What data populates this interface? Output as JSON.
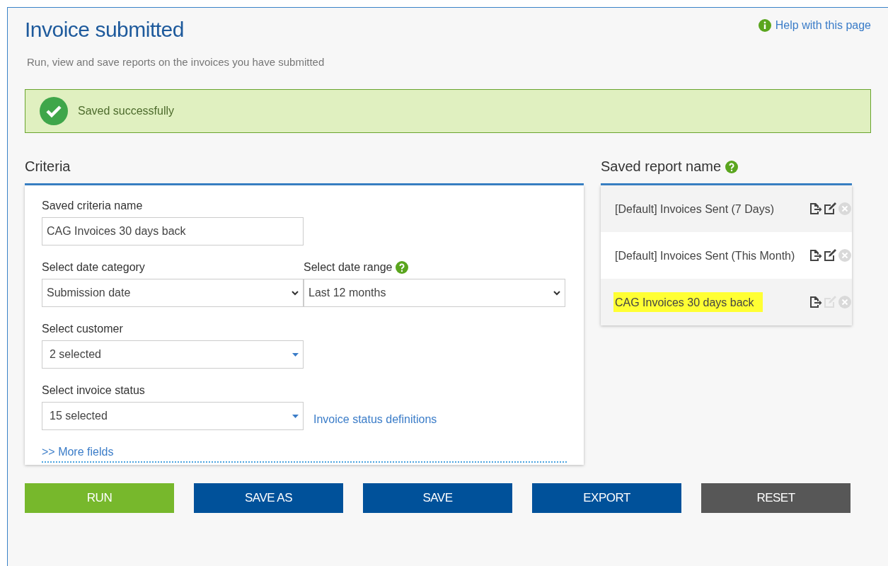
{
  "page": {
    "title": "Invoice submitted",
    "subtitle": "Run, view and save reports on the invoices you have submitted",
    "help_link": "Help with this page"
  },
  "alert": {
    "kind": "success",
    "message": "Saved successfully"
  },
  "criteria": {
    "heading": "Criteria",
    "name_field": {
      "label": "Saved criteria name",
      "value": "CAG Invoices 30 days back"
    },
    "date_category": {
      "label": "Select date category",
      "value": "Submission date"
    },
    "date_range": {
      "label": "Select date range",
      "value": "Last 12 months"
    },
    "customer": {
      "label": "Select customer",
      "value": "2 selected"
    },
    "invoice_status": {
      "label": "Select invoice status",
      "value": "15 selected",
      "link": "Invoice status definitions"
    },
    "more_fields": ">> More fields"
  },
  "saved_reports": {
    "heading": "Saved report name",
    "items": [
      {
        "name": "[Default] Invoices Sent (7 Days)",
        "highlighted": false,
        "edit_disabled": false
      },
      {
        "name": "[Default] Invoices Sent (This Month)",
        "highlighted": false,
        "edit_disabled": false
      },
      {
        "name": "CAG Invoices 30 days back",
        "highlighted": true,
        "edit_disabled": true
      }
    ]
  },
  "buttons": [
    {
      "label": "RUN",
      "kind": "go"
    },
    {
      "label": "SAVE AS",
      "kind": "primary"
    },
    {
      "label": "SAVE",
      "kind": "primary"
    },
    {
      "label": "EXPORT",
      "kind": "primary"
    },
    {
      "label": "RESET",
      "kind": "neutral"
    }
  ]
}
